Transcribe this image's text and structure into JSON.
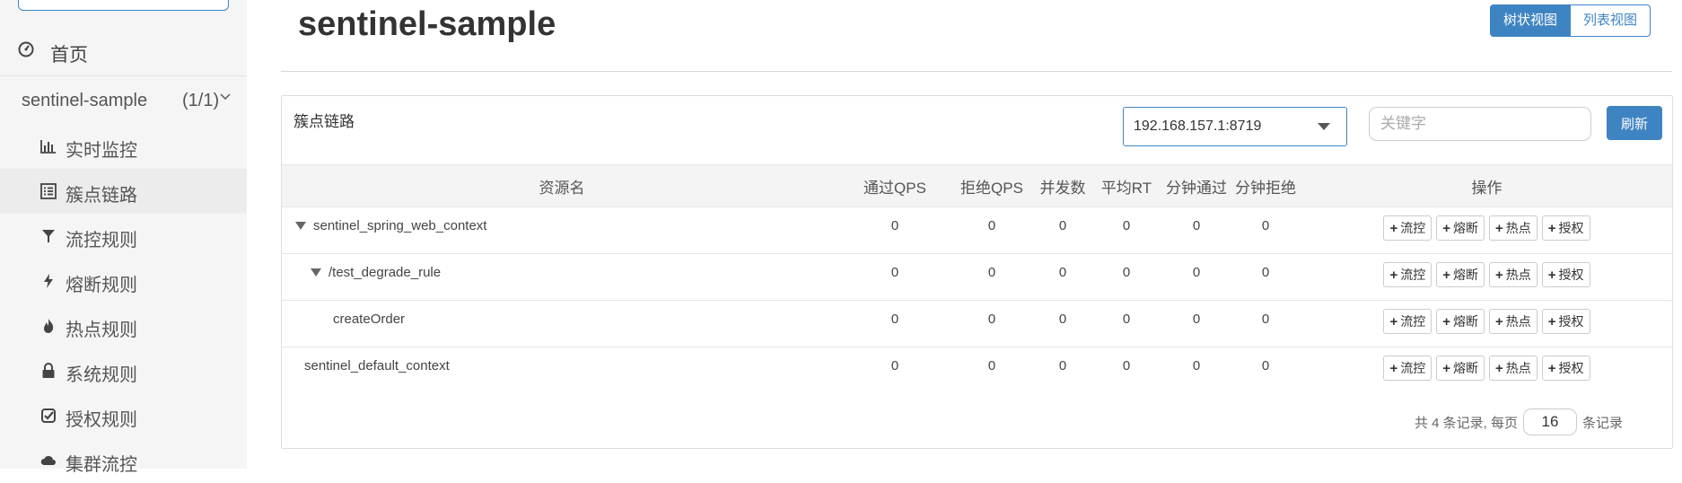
{
  "sidebar": {
    "home_label": "首页",
    "app": {
      "name": "sentinel-sample",
      "count": "(1/1)"
    },
    "items": [
      {
        "label": "实时监控",
        "icon": "bar-chart-icon",
        "active": false
      },
      {
        "label": "簇点链路",
        "icon": "list-icon",
        "active": true
      },
      {
        "label": "流控规则",
        "icon": "filter-icon",
        "active": false
      },
      {
        "label": "熔断规则",
        "icon": "bolt-icon",
        "active": false
      },
      {
        "label": "热点规则",
        "icon": "fire-icon",
        "active": false
      },
      {
        "label": "系统规则",
        "icon": "lock-icon",
        "active": false
      },
      {
        "label": "授权规则",
        "icon": "check-square-icon",
        "active": false
      },
      {
        "label": "集群流控",
        "icon": "cloud-icon",
        "active": false
      }
    ]
  },
  "header": {
    "title": "sentinel-sample",
    "view_tree": "树状视图",
    "view_list": "列表视图"
  },
  "panel": {
    "title": "簇点链路",
    "machine": "192.168.157.1:8719",
    "keyword_placeholder": "关键字",
    "refresh": "刷新"
  },
  "table": {
    "columns": [
      "资源名",
      "通过QPS",
      "拒绝QPS",
      "并发数",
      "平均RT",
      "分钟通过",
      "分钟拒绝",
      "操作"
    ],
    "rows": [
      {
        "name": "sentinel_spring_web_context",
        "level": 0,
        "expandable": true,
        "values": [
          "0",
          "0",
          "0",
          "0",
          "0",
          "0"
        ]
      },
      {
        "name": "/test_degrade_rule",
        "level": 1,
        "expandable": true,
        "values": [
          "0",
          "0",
          "0",
          "0",
          "0",
          "0"
        ]
      },
      {
        "name": "createOrder",
        "level": 2,
        "expandable": false,
        "values": [
          "0",
          "0",
          "0",
          "0",
          "0",
          "0"
        ]
      },
      {
        "name": "sentinel_default_context",
        "level": 0,
        "expandable": false,
        "values": [
          "0",
          "0",
          "0",
          "0",
          "0",
          "0"
        ]
      }
    ],
    "actions": [
      "流控",
      "熔断",
      "热点",
      "授权"
    ]
  },
  "pager": {
    "prefix": "共 4 条记录, 每页",
    "page_size": "16",
    "suffix": "条记录"
  }
}
